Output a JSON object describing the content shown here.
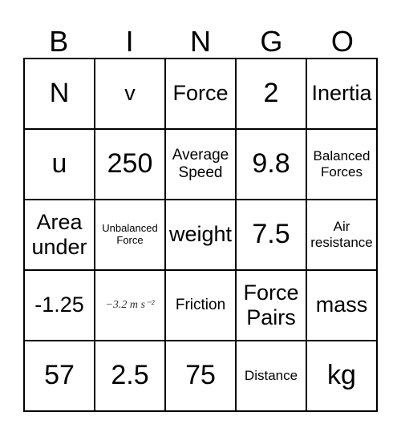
{
  "header": [
    "B",
    "I",
    "N",
    "G",
    "O"
  ],
  "cells": [
    [
      "N",
      "v",
      "Force",
      "2",
      "Inertia"
    ],
    [
      "u",
      "250",
      "Average Speed",
      "9.8",
      "Balanced Forces"
    ],
    [
      "Area under",
      "Unbalanced Force",
      "weight",
      "7.5",
      "Air resistance"
    ],
    [
      "-1.25",
      "−3.2 m s⁻²",
      "Friction",
      "Force Pairs",
      "mass"
    ],
    [
      "57",
      "2.5",
      "75",
      "Distance",
      "kg"
    ]
  ]
}
